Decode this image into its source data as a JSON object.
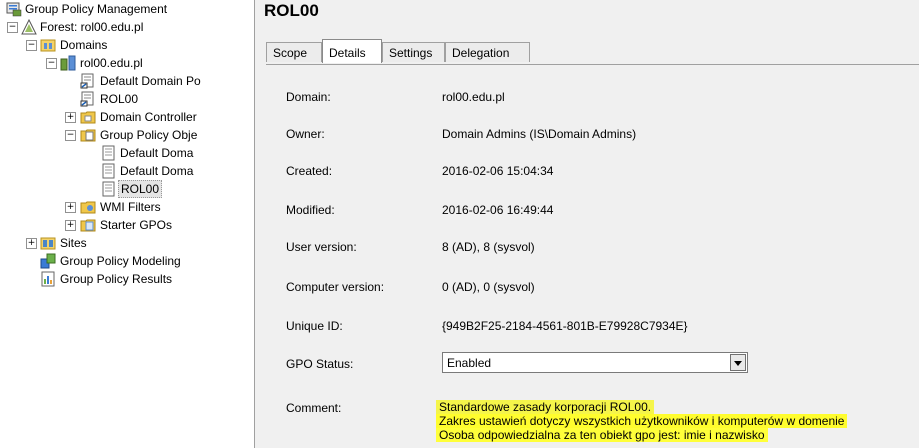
{
  "tree": {
    "root": "Group Policy Management",
    "forest": "Forest: rol00.edu.pl",
    "domains": "Domains",
    "domain": "rol00.edu.pl",
    "default_domain_policy": "Default Domain Po",
    "rol00_link": "ROL00",
    "domain_controllers": "Domain Controller",
    "gpo_container": "Group Policy Obje",
    "gpo_default_1": "Default Doma",
    "gpo_default_2": "Default Doma",
    "gpo_rol00": "ROL00",
    "wmi_filters": "WMI Filters",
    "starter_gpos": "Starter GPOs",
    "sites": "Sites",
    "modeling": "Group Policy Modeling",
    "results": "Group Policy Results",
    "expand_plus": "+",
    "expand_minus": "−"
  },
  "header": {
    "title": "ROL00"
  },
  "tabs": [
    "Scope",
    "Details",
    "Settings",
    "Delegation"
  ],
  "details": {
    "domain_label": "Domain:",
    "domain_value": "rol00.edu.pl",
    "owner_label": "Owner:",
    "owner_value": "Domain Admins (IS\\Domain Admins)",
    "created_label": "Created:",
    "created_value": "2016-02-06 15:04:34",
    "modified_label": "Modified:",
    "modified_value": "2016-02-06 16:49:44",
    "user_version_label": "User version:",
    "user_version_value": "8 (AD), 8 (sysvol)",
    "computer_version_label": "Computer version:",
    "computer_version_value": "0 (AD), 0 (sysvol)",
    "unique_id_label": "Unique ID:",
    "unique_id_value": "{949B2F25-2184-4561-801B-E79928C7934E}",
    "gpo_status_label": "GPO Status:",
    "gpo_status_value": "Enabled",
    "comment_label": "Comment:",
    "comment_lines": [
      "Standardowe zasady korporacji ROL00.",
      "Zakres ustawień dotyczy wszystkich użytkowników i komputerów w domenie",
      "Osoba odpowiedzialna za ten obiekt gpo jest: imie i nazwisko"
    ]
  },
  "colors": {
    "highlight": "#ffff33",
    "panel": "#f0f0f0"
  }
}
